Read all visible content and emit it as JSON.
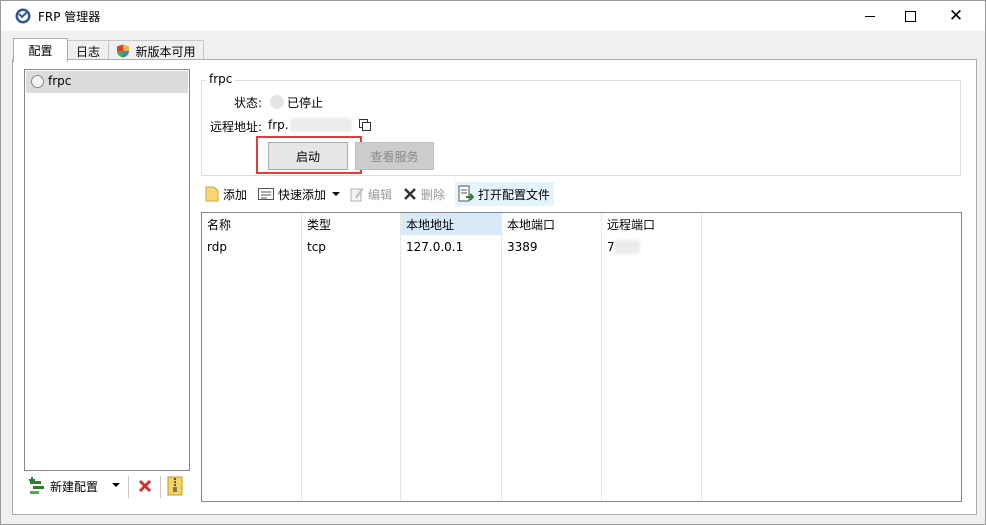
{
  "window": {
    "title": "FRP 管理器"
  },
  "tabs": [
    {
      "label": "配置"
    },
    {
      "label": "日志"
    },
    {
      "label": "新版本可用"
    }
  ],
  "config_list": [
    {
      "name": "frpc"
    }
  ],
  "left_toolbar": {
    "new_label": "新建配置"
  },
  "detail": {
    "group_title": "frpc",
    "status_label": "状态:",
    "status_value": "已停止",
    "remote_label": "远程地址:",
    "remote_value": "frp.",
    "start_button": "启动",
    "view_button": "查看服务"
  },
  "proxy_toolbar": {
    "add": "添加",
    "quick_add": "快速添加",
    "edit": "编辑",
    "delete": "删除",
    "open_file": "打开配置文件"
  },
  "table": {
    "columns": [
      "名称",
      "类型",
      "本地地址",
      "本地端口",
      "远程端口"
    ],
    "rows": [
      [
        "rdp",
        "tcp",
        "127.0.0.1",
        "3389",
        "7"
      ]
    ]
  },
  "colors": {
    "highlight": "#e33a3a",
    "selected_header": "#d9ebf9"
  }
}
